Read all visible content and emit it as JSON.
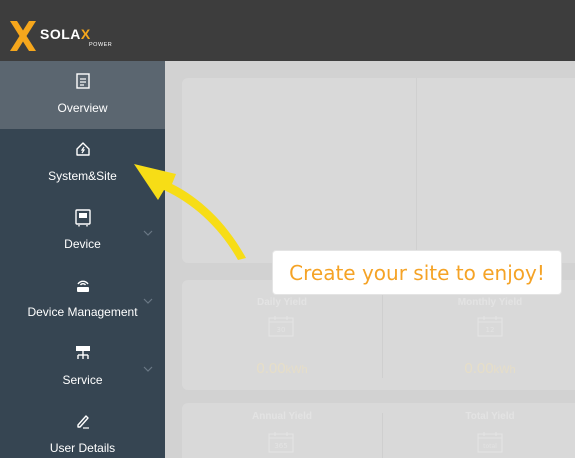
{
  "brand": {
    "name_main": "SOLA",
    "name_accent": "X",
    "tagline": "POWER",
    "accent_color": "#f6a71c"
  },
  "sidebar": {
    "items": [
      {
        "label": "Overview",
        "icon": "document-icon",
        "active": true
      },
      {
        "label": "System&Site",
        "icon": "house-icon",
        "active": false
      },
      {
        "label": "Device",
        "icon": "inverter-icon",
        "active": false,
        "expandable": true
      },
      {
        "label": "Device Management",
        "icon": "router-icon",
        "active": false,
        "expandable": true
      },
      {
        "label": "Service",
        "icon": "network-icon",
        "active": false,
        "expandable": true
      },
      {
        "label": "User Details",
        "icon": "pencil-icon",
        "active": false
      }
    ]
  },
  "stats": {
    "daily": {
      "label": "Daily Yield",
      "cal": "30",
      "value": "0.00",
      "unit": "kWh"
    },
    "monthly": {
      "label": "Monthly Yield",
      "cal": "12",
      "value": "0.00",
      "unit": "kWh"
    },
    "annual": {
      "label": "Annual Yield",
      "cal": "365"
    },
    "total": {
      "label": "Total Yield",
      "cal": "total"
    }
  },
  "tooltip": {
    "text": "Create your site to enjoy!",
    "color": "#f5a326"
  },
  "arrow": {
    "color": "#f7dd16",
    "points_to": "System&Site"
  }
}
